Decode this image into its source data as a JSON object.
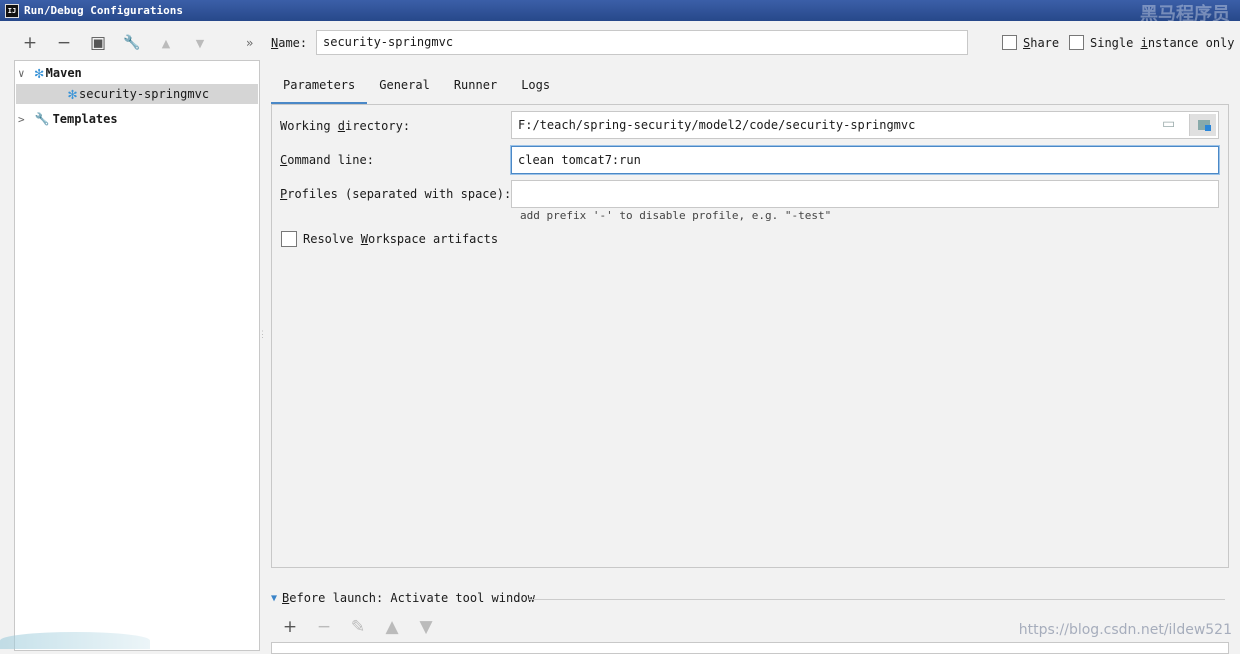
{
  "window": {
    "title": "Run/Debug Configurations",
    "watermark": "黑马程序员"
  },
  "toolbar": {
    "add": "+",
    "remove": "−",
    "copy": "▣",
    "edit": "🔧",
    "up": "▲",
    "down": "▼",
    "more": "»"
  },
  "tree": {
    "maven_label": "Maven",
    "maven_child": "security-springmvc",
    "templates_label": "Templates"
  },
  "config": {
    "name_label_u": "N",
    "name_label_rest": "ame:",
    "name_value": "security-springmvc",
    "share_u": "S",
    "share_rest": "hare",
    "single_pre": "Single ",
    "single_u": "i",
    "single_rest": "nstance only"
  },
  "tabs": [
    "Parameters",
    "General",
    "Runner",
    "Logs"
  ],
  "parameters": {
    "working_dir_pre": "Working ",
    "working_dir_u": "d",
    "working_dir_rest": "irectory:",
    "working_dir_value": "F:/teach/spring-security/model2/code/security-springmvc",
    "cmd_u": "C",
    "cmd_rest": "ommand line:",
    "cmd_value": "clean tomcat7:run",
    "profiles_u": "P",
    "profiles_rest": "rofiles (separated with space):",
    "profiles_value": "",
    "profiles_hint": "add prefix '-' to disable profile, e.g. \"-test\"",
    "resolve_pre": "Resolve ",
    "resolve_u": "W",
    "resolve_rest": "orkspace artifacts"
  },
  "before_launch": {
    "label_u": "B",
    "label_rest": "efore launch: Activate tool window",
    "add": "+",
    "remove": "−",
    "edit": "✎",
    "up": "▲",
    "down": "▼"
  },
  "footer": {
    "url": "https://blog.csdn.net/ildew521"
  },
  "colors": {
    "title_bar": "#2c4e92",
    "accent": "#4a88c7",
    "gear": "#3a94d8"
  }
}
